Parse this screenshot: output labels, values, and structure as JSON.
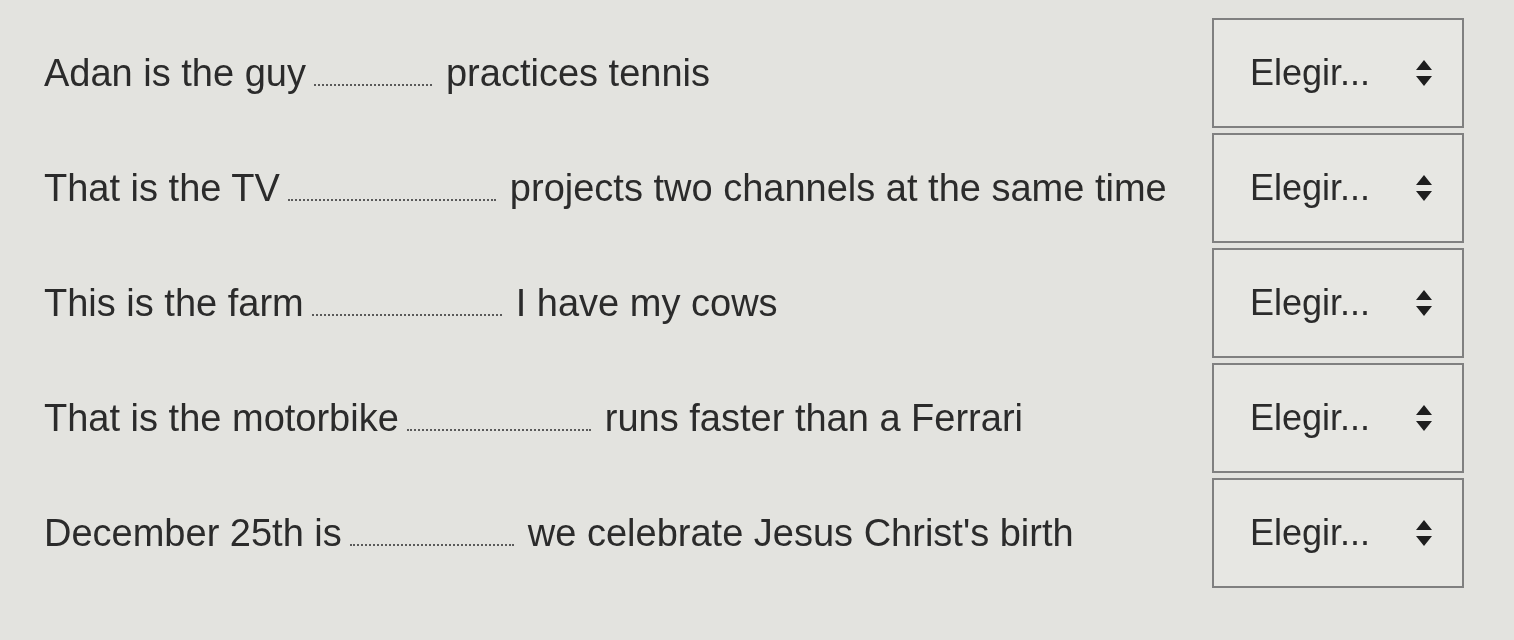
{
  "questions": [
    {
      "before": "Adan is the guy",
      "after": "practices tennis",
      "choice": "Elegir..."
    },
    {
      "before": "That is the TV",
      "after": "projects two channels at the same time",
      "choice": "Elegir..."
    },
    {
      "before": "This is the farm",
      "after": "I have my cows",
      "choice": "Elegir..."
    },
    {
      "before": "That is the motorbike",
      "after": "runs faster than a Ferrari",
      "choice": "Elegir..."
    },
    {
      "before": "December 25th is",
      "after": "we celebrate Jesus Christ's birth",
      "choice": "Elegir..."
    }
  ]
}
